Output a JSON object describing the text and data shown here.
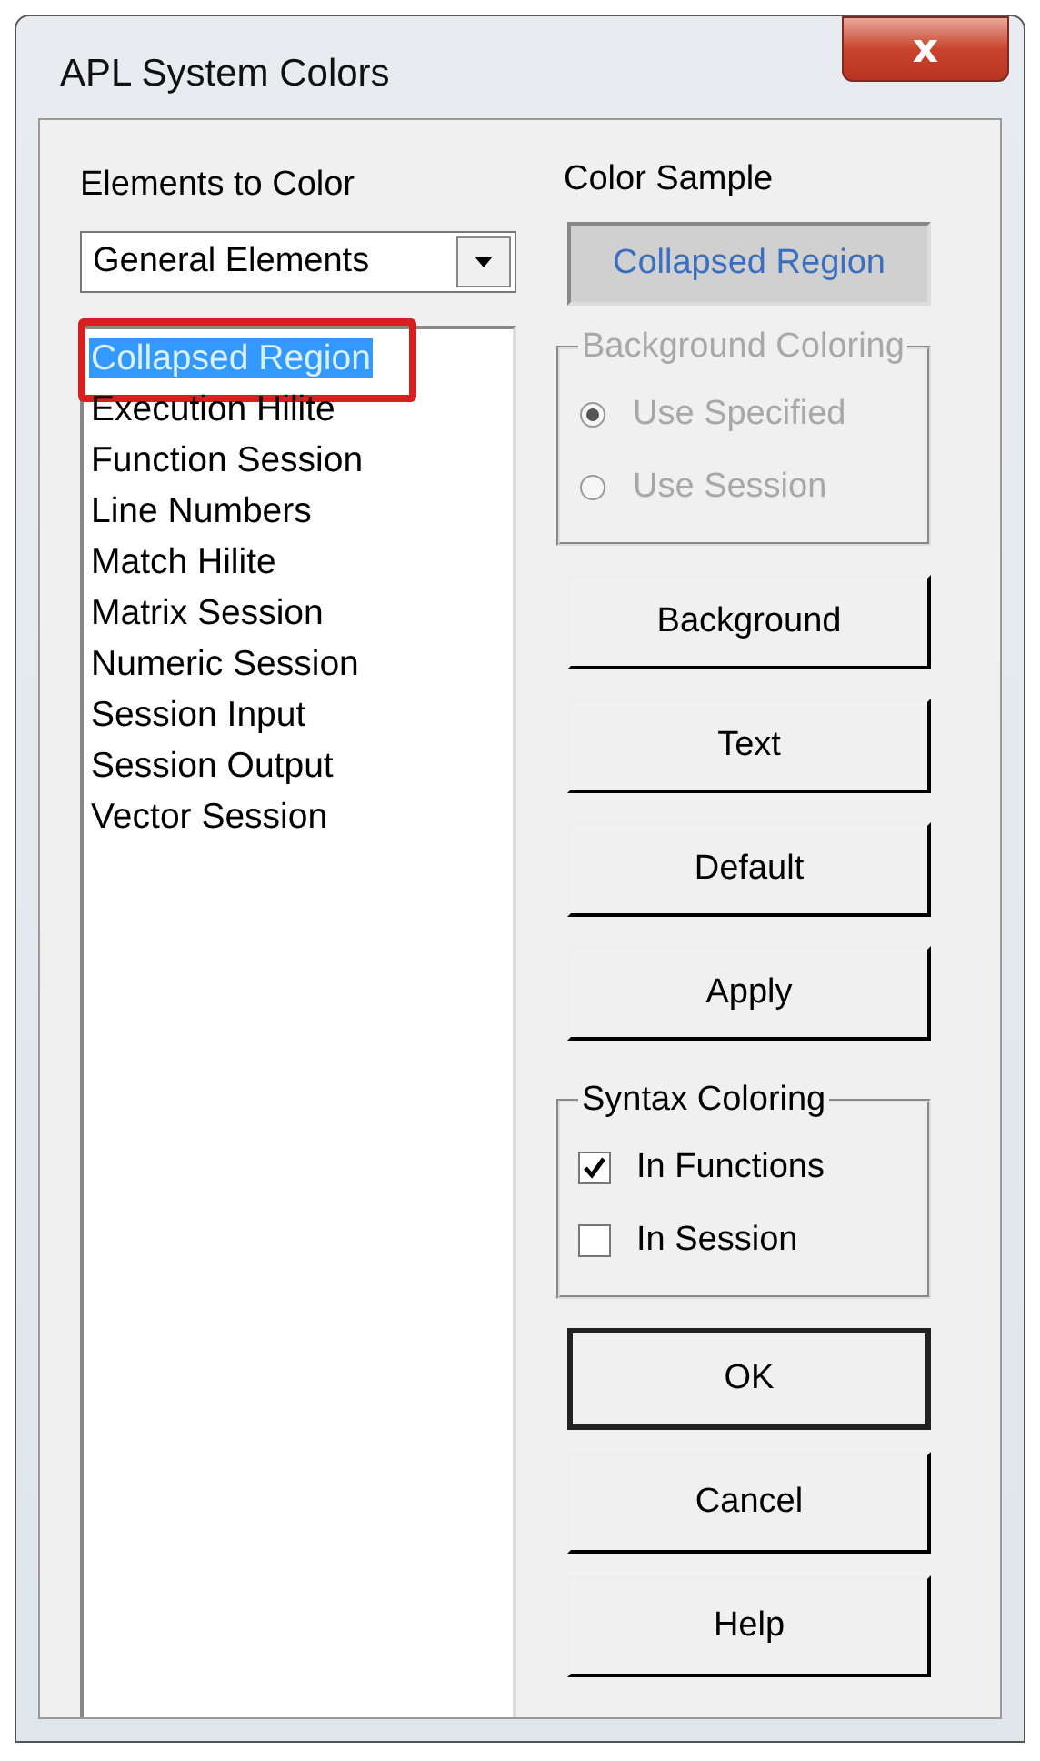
{
  "window": {
    "title": "APL System Colors",
    "close": "x"
  },
  "elements_label": "Elements to Color",
  "element_group": {
    "value": "General Elements"
  },
  "elements": [
    {
      "label": "Collapsed Region",
      "selected": true,
      "highlighted": true
    },
    {
      "label": "Execution Hilite",
      "selected": false,
      "highlighted": false
    },
    {
      "label": "Function Session",
      "selected": false,
      "highlighted": false
    },
    {
      "label": "Line Numbers",
      "selected": false,
      "highlighted": false
    },
    {
      "label": "Match Hilite",
      "selected": false,
      "highlighted": false
    },
    {
      "label": "Matrix Session",
      "selected": false,
      "highlighted": false
    },
    {
      "label": "Numeric Session",
      "selected": false,
      "highlighted": false
    },
    {
      "label": "Session Input",
      "selected": false,
      "highlighted": false
    },
    {
      "label": "Session Output",
      "selected": false,
      "highlighted": false
    },
    {
      "label": "Vector Session",
      "selected": false,
      "highlighted": false
    }
  ],
  "sample_label": "Color Sample",
  "sample": {
    "text": "Collapsed Region",
    "color": "#3a6fc0"
  },
  "background_coloring": {
    "title": "Background Coloring",
    "disabled": true,
    "options": [
      {
        "label": "Use Specified",
        "selected": true
      },
      {
        "label": "Use Session",
        "selected": false
      }
    ]
  },
  "color_buttons": [
    "Background",
    "Text",
    "Default",
    "Apply"
  ],
  "syntax_coloring": {
    "title": "Syntax Coloring",
    "options": [
      {
        "label": "In Functions",
        "checked": true
      },
      {
        "label": "In Session",
        "checked": false
      }
    ]
  },
  "dialog_buttons": [
    {
      "label": "OK",
      "default": true
    },
    {
      "label": "Cancel",
      "default": false
    },
    {
      "label": "Help",
      "default": false
    }
  ]
}
